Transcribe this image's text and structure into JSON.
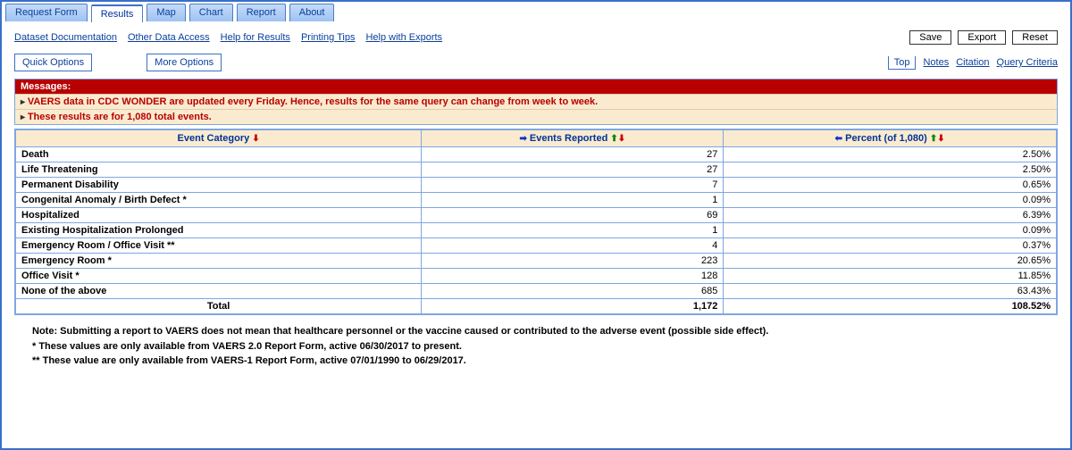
{
  "tabs": [
    "Request Form",
    "Results",
    "Map",
    "Chart",
    "Report",
    "About"
  ],
  "activeTab": 1,
  "links": [
    "Dataset Documentation",
    "Other Data Access",
    "Help for Results",
    "Printing Tips",
    "Help with Exports"
  ],
  "buttons": {
    "save": "Save",
    "export": "Export",
    "reset": "Reset"
  },
  "opts": {
    "quick": "Quick Options",
    "more": "More Options"
  },
  "rnav": {
    "top": "Top",
    "notes": "Notes",
    "citation": "Citation",
    "query": "Query Criteria"
  },
  "messages": {
    "header": "Messages:",
    "m1": "VAERS data in CDC WONDER are updated every Friday. Hence, results for the same query can change from week to week.",
    "m2": "These results are for 1,080 total events."
  },
  "headers": {
    "cat": "Event Category",
    "ev": "Events Reported",
    "pct": "Percent (of 1,080)"
  },
  "rows": [
    {
      "c": "Death",
      "e": "27",
      "p": "2.50%"
    },
    {
      "c": "Life Threatening",
      "e": "27",
      "p": "2.50%"
    },
    {
      "c": "Permanent Disability",
      "e": "7",
      "p": "0.65%"
    },
    {
      "c": "Congenital Anomaly / Birth Defect *",
      "e": "1",
      "p": "0.09%"
    },
    {
      "c": "Hospitalized",
      "e": "69",
      "p": "6.39%"
    },
    {
      "c": "Existing Hospitalization Prolonged",
      "e": "1",
      "p": "0.09%"
    },
    {
      "c": "Emergency Room / Office Visit **",
      "e": "4",
      "p": "0.37%"
    },
    {
      "c": "Emergency Room *",
      "e": "223",
      "p": "20.65%"
    },
    {
      "c": "Office Visit *",
      "e": "128",
      "p": "11.85%"
    },
    {
      "c": "None of the above",
      "e": "685",
      "p": "63.43%"
    }
  ],
  "total": {
    "label": "Total",
    "e": "1,172",
    "p": "108.52%"
  },
  "notes": {
    "n1": "Note: Submitting a report to VAERS does not mean that healthcare personnel or the vaccine caused or contributed to the adverse event (possible side effect).",
    "n2": "* These values are only available from VAERS 2.0 Report Form, active 06/30/2017 to present.",
    "n3": "** These value are only available from VAERS-1 Report Form, active 07/01/1990 to 06/29/2017."
  }
}
